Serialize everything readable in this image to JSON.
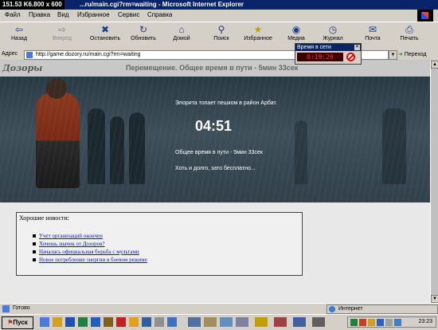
{
  "window": {
    "fps_overlay": "151.53 K6.800 x 600",
    "title": "...ru/main.cgi?rm=waiting - Microsoft Internet Explorer"
  },
  "menu": [
    "Файл",
    "Правка",
    "Вид",
    "Избранное",
    "Сервис",
    "Справка"
  ],
  "toolbar": [
    {
      "label": "Назад",
      "icon": "back-arrow-icon",
      "enabled": true
    },
    {
      "label": "Вперед",
      "icon": "forward-arrow-icon",
      "enabled": false
    },
    {
      "label": "Остановить",
      "icon": "stop-icon",
      "enabled": true
    },
    {
      "label": "Обновить",
      "icon": "refresh-icon",
      "enabled": true
    },
    {
      "label": "Домой",
      "icon": "home-icon",
      "enabled": true
    },
    {
      "label": "Поиск",
      "icon": "search-icon",
      "enabled": true
    },
    {
      "label": "Избранное",
      "icon": "favorites-icon",
      "enabled": true
    },
    {
      "label": "Медиа",
      "icon": "media-icon",
      "enabled": true
    },
    {
      "label": "Журнал",
      "icon": "history-icon",
      "enabled": true
    },
    {
      "label": "Почта",
      "icon": "mail-icon",
      "enabled": true
    },
    {
      "label": "Печать",
      "icon": "print-icon",
      "enabled": true
    }
  ],
  "address": {
    "label": "Адрес",
    "url": "http://game.dozory.ru/main.cgi?rm=waiting",
    "go_label": "Переход"
  },
  "online_popup": {
    "title": "Время в сети",
    "time": "0:19:26"
  },
  "page": {
    "logo": "Дозоры",
    "title": "Перемещение. Общее время в пути - 5мин 33сек",
    "message": "Элорита топает пешком в район Арбат.",
    "timer": "04:51",
    "total_time": "Общее время в пути - 5мин 33сек",
    "joke": "Хоть и долго, зато бесплатно..."
  },
  "news": {
    "title": "Хорошие новости:",
    "items": [
      "Учет организаций окончен",
      "Хочешь значок от Дозоров?",
      "Началась официальная борьба с мультами",
      "Новое потребление энергии в боевом режиме"
    ]
  },
  "status": {
    "text": "Готово",
    "zone": "Интернет"
  },
  "taskbar": {
    "start": "Пуск",
    "clock": "23:23"
  },
  "colors": {
    "titlebar": "#0a246a",
    "link": "#1010c0",
    "timer_red": "#ff3030"
  }
}
